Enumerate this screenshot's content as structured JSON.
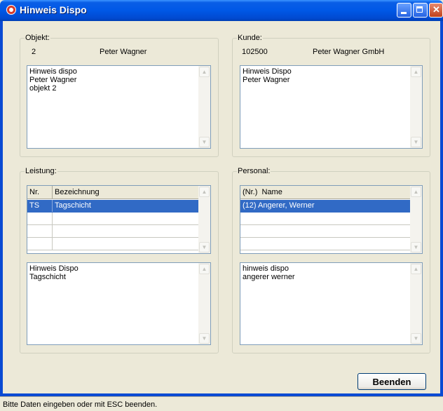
{
  "window": {
    "title": "Hinweis Dispo"
  },
  "objekt": {
    "legend": "Objekt:",
    "number": "2",
    "name": "Peter Wagner",
    "note": "Hinweis dispo\nPeter Wagner\nobjekt 2"
  },
  "kunde": {
    "legend": "Kunde:",
    "number": "102500",
    "name": "Peter Wagner GmbH",
    "note": "Hinweis Dispo\nPeter Wagner"
  },
  "leistung": {
    "legend": "Leistung:",
    "columns": [
      "Nr.",
      "Bezeichnung"
    ],
    "rows": [
      {
        "nr": "TS",
        "bezeichnung": "Tagschicht",
        "selected": true
      },
      {
        "nr": "",
        "bezeichnung": ""
      },
      {
        "nr": "",
        "bezeichnung": ""
      },
      {
        "nr": "",
        "bezeichnung": ""
      }
    ],
    "note": "Hinweis Dispo\nTagschicht"
  },
  "personal": {
    "legend": "Personal:",
    "columns": [
      "(Nr.)  Name"
    ],
    "rows": [
      {
        "name": "(12) Angerer, Werner",
        "selected": true
      },
      {
        "name": ""
      },
      {
        "name": ""
      },
      {
        "name": ""
      }
    ],
    "note": "hinweis dispo\nangerer werner"
  },
  "buttons": {
    "close": "Beenden"
  },
  "status": {
    "text": "Bitte Daten eingeben oder mit ESC beenden."
  },
  "icons": {
    "app": "app-icon",
    "minimize": "minimize-icon",
    "maximize": "maximize-icon",
    "close": "close-icon",
    "scroll_up": "scroll-up-arrow-icon",
    "scroll_down": "scroll-down-arrow-icon"
  },
  "colors": {
    "titlebar": "#0058e6",
    "selection": "#316ac5",
    "window_bg": "#ece9d8"
  }
}
